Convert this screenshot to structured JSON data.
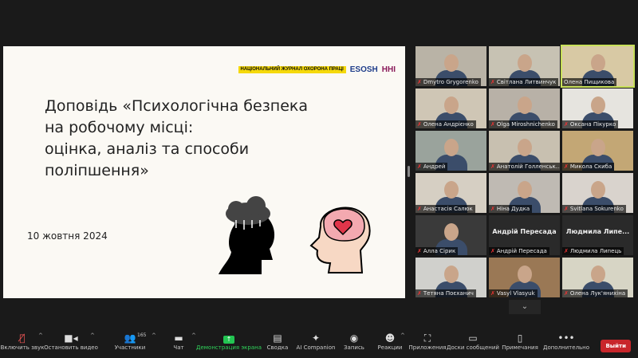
{
  "slide": {
    "logos": [
      "НАЦІОНАЛЬНИЙ ЖУРНАЛ ОХОРОНА ПРАЦІ",
      "ESOSH",
      "ННІ"
    ],
    "title": "Доповідь «Психологічна безпека\n на робочому місці:\nоцінка, аналіз та способи\nполіпшення»",
    "date": "10 жовтня 2024"
  },
  "participants": [
    {
      "name": "Dmytro Grygorenko",
      "muted": true,
      "video": true
    },
    {
      "name": "Світлана Литвинчук",
      "muted": true,
      "video": true
    },
    {
      "name": "Олена Пищикова",
      "muted": false,
      "video": true,
      "active": true
    },
    {
      "name": "Олена Андрієнко",
      "muted": true,
      "video": true
    },
    {
      "name": "Olga Miroshnichenko",
      "muted": true,
      "video": true
    },
    {
      "name": "Оксана Пікурко",
      "muted": true,
      "video": true
    },
    {
      "name": "Андрей",
      "muted": true,
      "video": true
    },
    {
      "name": "Анатолій Голленськ...",
      "muted": true,
      "video": true
    },
    {
      "name": "Микола Скиба",
      "muted": true,
      "video": true
    },
    {
      "name": "Анастасія Салюк",
      "muted": true,
      "video": true
    },
    {
      "name": "Ніна Дудка",
      "muted": true,
      "video": true
    },
    {
      "name": "Svitlana Sokurenko",
      "muted": true,
      "video": true
    },
    {
      "name": "Алла Сірик",
      "muted": true,
      "video": true
    },
    {
      "name": "Андрій Пересада",
      "muted": true,
      "video": false,
      "display": "Андрій Пересада"
    },
    {
      "name": "Людмила Липець",
      "muted": true,
      "video": false,
      "display": "Людмила Липе..."
    },
    {
      "name": "Тетяна Поєханич",
      "muted": true,
      "video": true
    },
    {
      "name": "Vasyl Vlasyuk",
      "muted": true,
      "video": true
    },
    {
      "name": "Олена Лук'янихіна",
      "muted": true,
      "video": true
    }
  ],
  "toolbar": {
    "unmute": "Включить звук",
    "video": "Остановить видео",
    "participants": "Участники",
    "participants_count": "165",
    "chat": "Чат",
    "share": "Демонстрация экрана",
    "summary": "Сводка",
    "ai": "AI Companion",
    "record": "Запись",
    "reactions": "Реакции",
    "apps": "Приложения",
    "whiteboards": "Доски сообщений",
    "notes": "Примечания",
    "more": "Дополнительно",
    "leave": "Выйти"
  }
}
